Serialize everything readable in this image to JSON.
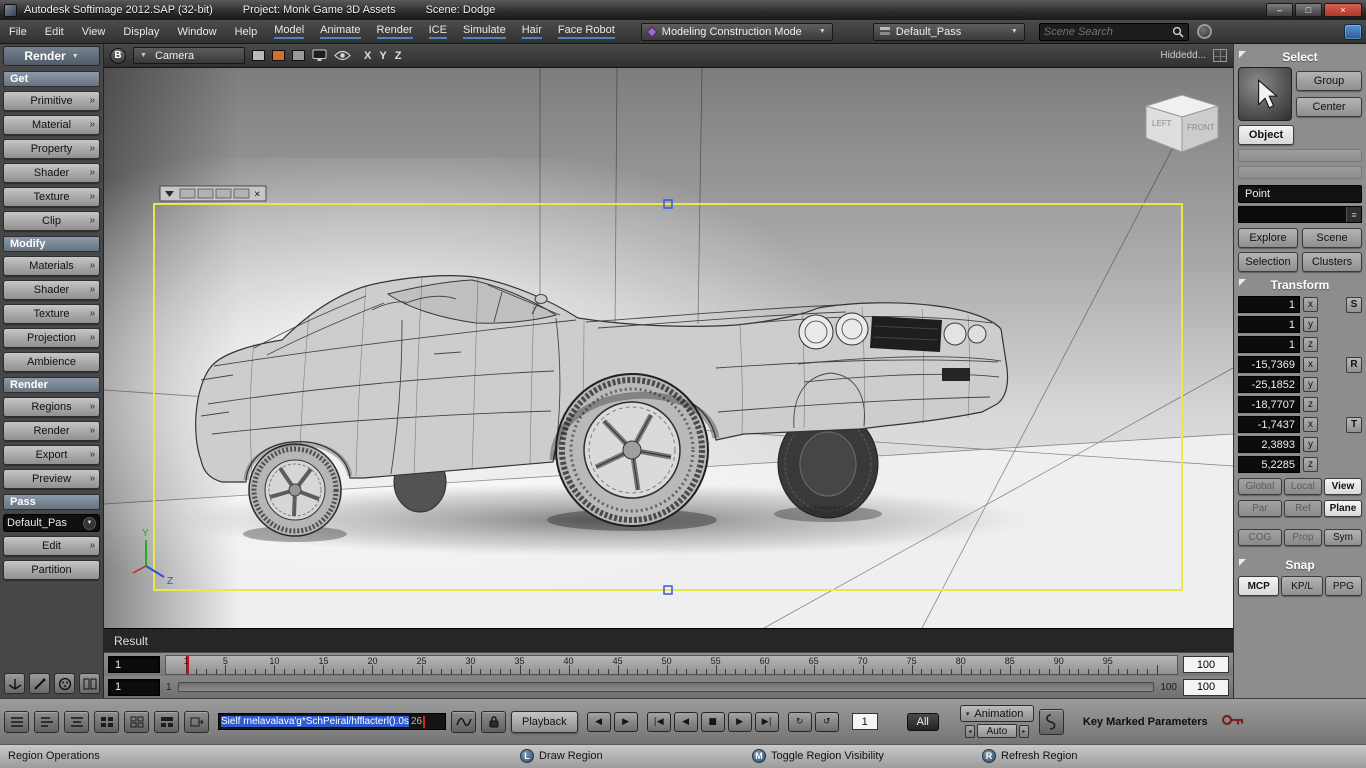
{
  "colors": {
    "region_border": "#e8e84a",
    "selection_blue": "#2f5bd0",
    "close_button_red": "#b5382a",
    "module_underline": "#4d83c4"
  },
  "icons": {
    "close": "×",
    "minimize": "–",
    "maximize": "□",
    "caret_down": "▼",
    "caret_small": "▾",
    "chevron_right": "»",
    "spinner_left": "◂",
    "spinner_right": "▸"
  },
  "title_bar": {
    "app_title": "Autodesk Softimage 2012.SAP (32-bit)",
    "project": "Project: Monk Game 3D Assets",
    "scene": "Scene: Dodge"
  },
  "menu_bar": {
    "menus": [
      "File",
      "Edit",
      "View",
      "Display",
      "Window",
      "Help"
    ],
    "module_menus": [
      "Model",
      "Animate",
      "Render",
      "ICE",
      "Simulate",
      "Hair",
      "Face Robot"
    ],
    "construction_mode": "Modeling Construction Mode",
    "pass_selector": "Default_Pass",
    "search_placeholder": "Scene Search"
  },
  "left_panel": {
    "panel_header": "Render",
    "get_header": "Get",
    "get_items": [
      "Primitive",
      "Material",
      "Property",
      "Shader",
      "Texture",
      "Clip"
    ],
    "modify_header": "Modify",
    "modify_items": [
      "Materials",
      "Shader",
      "Texture",
      "Projection",
      "Ambience"
    ],
    "render_header": "Render",
    "render_items": [
      "Regions",
      "Render",
      "Export",
      "Preview"
    ],
    "pass_header": "Pass",
    "pass_dropdown": "Default_Pas",
    "pass_items": [
      "Edit",
      "Partition"
    ]
  },
  "viewport": {
    "b_button": "B",
    "camera_menu": "Camera",
    "axis_letters": [
      "X",
      "Y",
      "Z"
    ],
    "display_mode": "Hiddedd...",
    "result_label": "Result",
    "view_cube_left": "LEFT",
    "view_cube_front": "FRONT",
    "axis_indicator": {
      "y": "Y",
      "z": "Z"
    }
  },
  "timeline": {
    "current_frame": "1",
    "total_frames": 100,
    "tick_labels": [
      "1",
      "5",
      "10",
      "15",
      "20",
      "25",
      "30",
      "35",
      "40",
      "45",
      "50",
      "55",
      "60",
      "65",
      "70",
      "75",
      "80",
      "85",
      "90",
      "95"
    ],
    "end_frame_box": "100",
    "range_frame_field": "1",
    "range_start": "1",
    "range_end": "100",
    "range_end_box": "100"
  },
  "playback": {
    "script_selected_text": "Sielf rnelavalava'g*SchPeiral/hfflacterl().0s",
    "script_suffix": "26",
    "playback_button": "Playback",
    "transport": {
      "prev_frame": "◀",
      "next_frame": "▶",
      "go_to_start": "|◀",
      "play_backwards": "◀",
      "stop": "■",
      "play": "▶",
      "go_to_end": "▶|",
      "loop": "↻",
      "repeat": "↺"
    },
    "frame_field": "1",
    "all_button": "All",
    "animation_menu": "Animation",
    "auto_button": "Auto",
    "key_marked_label": "Key Marked Parameters"
  },
  "right_panel": {
    "select_header": "Select",
    "group_button": "Group",
    "center_button": "Center",
    "object_button": "Object",
    "point_label": "Point",
    "explore_button": "Explore",
    "scene_button": "Scene",
    "selection_button": "Selection",
    "clusters_button": "Clusters",
    "transform_header": "Transform",
    "transform": {
      "scale": [
        "1",
        "1",
        "1"
      ],
      "rotation": [
        "-15,7369",
        "-25,1852",
        "-18,7707"
      ],
      "translation": [
        "-1,7437",
        "2,3893",
        "5,2285"
      ],
      "axes": [
        "x",
        "y",
        "z"
      ],
      "modes": [
        "S",
        "R",
        "T"
      ]
    },
    "space_buttons": [
      "Global",
      "Local",
      "View"
    ],
    "ref_buttons": [
      "Par",
      "Ref",
      "Plane"
    ],
    "extra_buttons": [
      "COG",
      "Prop",
      "Sym"
    ],
    "snap_header": "Snap",
    "tabs": [
      "MCP",
      "KP/L",
      "PPG"
    ]
  },
  "status_bar": {
    "mode_label": "Region Operations",
    "hints": [
      {
        "key": "L",
        "label": "Draw Region"
      },
      {
        "key": "M",
        "label": "Toggle Region Visibility"
      },
      {
        "key": "R",
        "label": "Refresh Region"
      }
    ]
  }
}
